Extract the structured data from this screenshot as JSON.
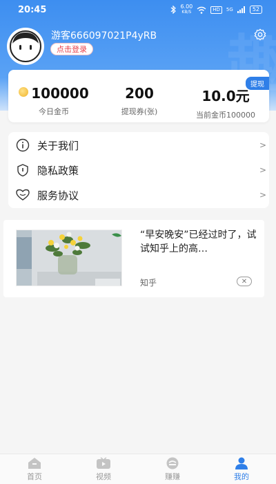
{
  "status_bar": {
    "time": "20:45",
    "net_speed": "6.00",
    "net_unit": "KB/S",
    "hd_badge": "HD",
    "signal_label": "5G",
    "battery": "52"
  },
  "profile": {
    "username": "游客666097021P4yRB",
    "login_button": "点击登录",
    "watermark": "趣"
  },
  "stats": {
    "withdraw_tag": "提现",
    "coins_today": {
      "value": "100000",
      "label": "今日金币"
    },
    "vouchers": {
      "value": "200",
      "label": "提现券(张)"
    },
    "balance": {
      "value": "10.0元",
      "label": "当前金币100000"
    }
  },
  "menu": {
    "items": [
      {
        "label": "关于我们",
        "icon": "info-icon"
      },
      {
        "label": "隐私政策",
        "icon": "shield-icon"
      },
      {
        "label": "服务协议",
        "icon": "heart-icon"
      }
    ],
    "chevron": ">"
  },
  "ad": {
    "title": "“早安晚安”已经过时了，试试知乎上的高…",
    "source": "知乎"
  },
  "nav": {
    "items": [
      {
        "label": "首页",
        "icon": "home-icon"
      },
      {
        "label": "视频",
        "icon": "video-icon"
      },
      {
        "label": "赚赚",
        "icon": "earn-icon"
      },
      {
        "label": "我的",
        "icon": "user-icon"
      }
    ],
    "active_index": 3
  },
  "colors": {
    "accent": "#2f7fe8",
    "header_top": "#3d8ef0",
    "login_text": "#e8424b"
  }
}
